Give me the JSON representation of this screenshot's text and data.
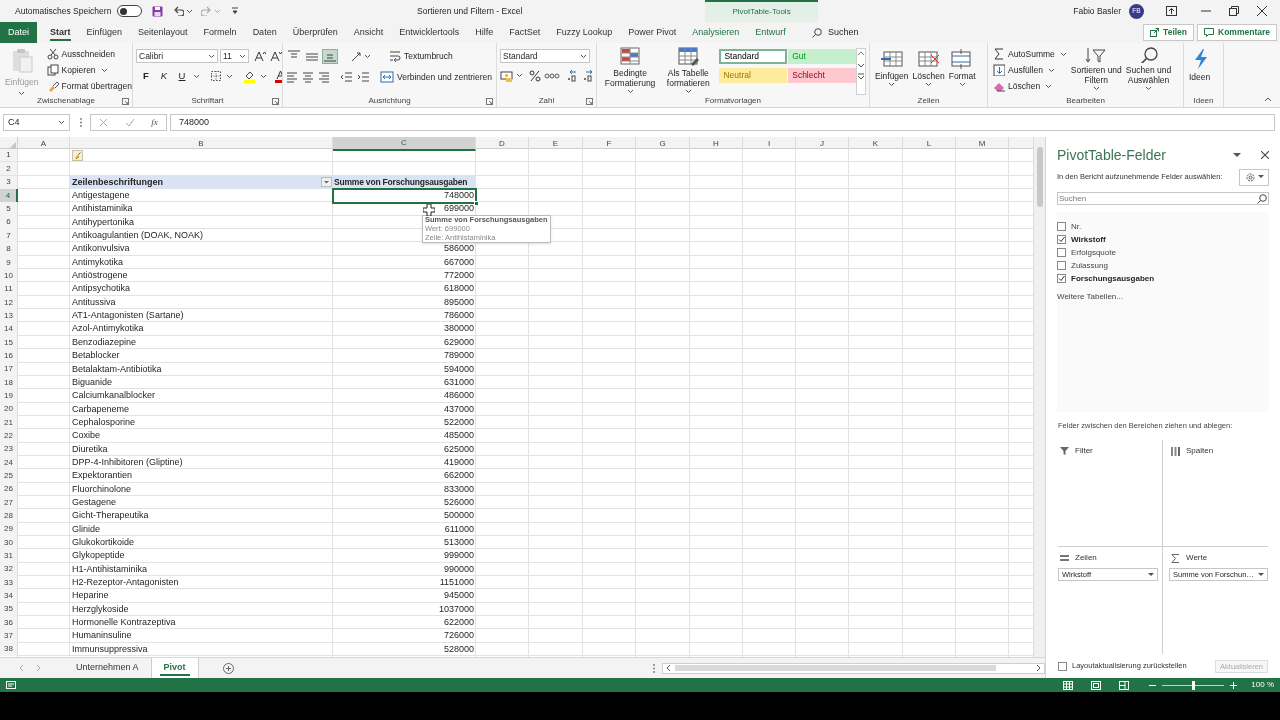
{
  "title_bar": {
    "autosave_label": "Automatisches Speichern",
    "autosave_on": false,
    "title": "Sortieren und Filtern - Excel",
    "context_tab": "PivotTable-Tools",
    "user": "Fabio Basler",
    "avatar": "FB"
  },
  "tabs": [
    {
      "label": "Datei",
      "kind": "file",
      "selected": false
    },
    {
      "label": "Start",
      "kind": "normal",
      "selected": true
    },
    {
      "label": "Einfügen",
      "kind": "normal",
      "selected": false
    },
    {
      "label": "Seitenlayout",
      "kind": "normal",
      "selected": false
    },
    {
      "label": "Formeln",
      "kind": "normal",
      "selected": false
    },
    {
      "label": "Daten",
      "kind": "normal",
      "selected": false
    },
    {
      "label": "Überprüfen",
      "kind": "normal",
      "selected": false
    },
    {
      "label": "Ansicht",
      "kind": "normal",
      "selected": false
    },
    {
      "label": "Entwicklertools",
      "kind": "normal",
      "selected": false
    },
    {
      "label": "Hilfe",
      "kind": "normal",
      "selected": false
    },
    {
      "label": "FactSet",
      "kind": "normal",
      "selected": false
    },
    {
      "label": "Fuzzy Lookup",
      "kind": "normal",
      "selected": false
    },
    {
      "label": "Power Pivot",
      "kind": "normal",
      "selected": false
    },
    {
      "label": "Analysieren",
      "kind": "context",
      "selected": false
    },
    {
      "label": "Entwurf",
      "kind": "context",
      "selected": false
    }
  ],
  "search": {
    "label": "Suchen"
  },
  "header_buttons": [
    {
      "label": "Teilen",
      "kind": "share"
    },
    {
      "label": "Kommentare",
      "kind": "comments"
    }
  ],
  "ribbon": {
    "groups": [
      {
        "kind": "clipboard",
        "label": "Zwischenablage",
        "items": [
          {
            "label": "Einfügen",
            "disabled": true
          },
          {
            "label": "Ausschneiden",
            "disabled": false
          },
          {
            "label": "Kopieren",
            "disabled": false
          },
          {
            "label": "Format übertragen",
            "disabled": false
          }
        ]
      },
      {
        "kind": "font",
        "label": "Schriftart",
        "font": "Calibri",
        "size": "11",
        "items": [
          {
            "label": "F",
            "kind": "bold"
          },
          {
            "label": "K",
            "kind": "italic"
          },
          {
            "label": "U",
            "kind": "underline"
          }
        ]
      },
      {
        "kind": "alignment",
        "label": "Ausrichtung",
        "align_buttons": [
          {
            "selected": false
          },
          {
            "selected": false
          },
          {
            "selected": true
          }
        ],
        "items": [
          {
            "label": "Textumbruch"
          },
          {
            "label": "Verbinden und zentrieren"
          }
        ]
      },
      {
        "kind": "number",
        "label": "Zahl",
        "format": "Standard"
      },
      {
        "kind": "styles",
        "label": "Formatvorlagen",
        "items": [
          {
            "label": "Bedingte\nFormatierung"
          },
          {
            "label": "Als Tabelle\nformatieren"
          }
        ],
        "styles": [
          {
            "label": "Standard",
            "color": "#ffffff"
          },
          {
            "label": "Gut",
            "color": "#c6efce"
          },
          {
            "label": "Neutral",
            "color": "#ffeb9c"
          },
          {
            "label": "Schlecht",
            "color": "#ffc7ce"
          }
        ]
      },
      {
        "kind": "cells",
        "label": "Zellen",
        "items": [
          {
            "label": "Einfügen"
          },
          {
            "label": "Löschen"
          },
          {
            "label": "Format"
          }
        ]
      },
      {
        "kind": "editing",
        "label": "Bearbeiten",
        "items": [
          {
            "label": "AutoSumme",
            "kind": "small"
          },
          {
            "label": "Ausfüllen",
            "kind": "small"
          },
          {
            "label": "Löschen",
            "kind": "small"
          },
          {
            "label": "Sortieren und\nFiltern",
            "kind": "large"
          },
          {
            "label": "Suchen und\nAuswählen",
            "kind": "large"
          }
        ]
      },
      {
        "kind": "ideas",
        "label": "Ideen",
        "items": [
          {
            "label": "Ideen"
          }
        ]
      }
    ]
  },
  "formula_bar": {
    "name_box": "C4",
    "function_button": "fx",
    "value": "748000"
  },
  "sheet": {
    "columns": [
      {
        "label": "A",
        "selected": false
      },
      {
        "label": "B",
        "selected": false
      },
      {
        "label": "C",
        "selected": true
      },
      {
        "label": "D",
        "selected": false
      },
      {
        "label": "E",
        "selected": false
      },
      {
        "label": "F",
        "selected": false
      },
      {
        "label": "G",
        "selected": false
      },
      {
        "label": "H",
        "selected": false
      },
      {
        "label": "I",
        "selected": false
      },
      {
        "label": "J",
        "selected": false
      },
      {
        "label": "K",
        "selected": false
      },
      {
        "label": "L",
        "selected": false
      },
      {
        "label": "M",
        "selected": false
      }
    ],
    "rows": [
      {
        "number": "1",
        "kind": "icon_row",
        "selected": false
      },
      {
        "number": "2",
        "kind": "empty",
        "selected": false
      },
      {
        "number": "3",
        "kind": "header",
        "selected": false,
        "label": "Zeilenbeschriftungen",
        "value": "Summe von Forschungsausgaben"
      },
      {
        "number": "4",
        "kind": "data",
        "selected": true,
        "label": "Antigestagene",
        "value": "748000"
      },
      {
        "number": "5",
        "kind": "data",
        "selected": false,
        "label": "Antihistaminika",
        "value": "699000"
      },
      {
        "number": "6",
        "kind": "data",
        "selected": false,
        "label": "Antihypertonika"
      },
      {
        "number": "7",
        "kind": "data",
        "selected": false,
        "label": "Antikoagulantien (DOAK, NOAK)"
      },
      {
        "number": "8",
        "kind": "data",
        "selected": false,
        "label": "Antikonvulsiva",
        "value": "586000"
      },
      {
        "number": "9",
        "kind": "data",
        "selected": false,
        "label": "Antimykotika",
        "value": "667000"
      },
      {
        "number": "10",
        "kind": "data",
        "selected": false,
        "label": "Antiöstrogene",
        "value": "772000"
      },
      {
        "number": "11",
        "kind": "data",
        "selected": false,
        "label": "Antipsychotika",
        "value": "618000"
      },
      {
        "number": "12",
        "kind": "data",
        "selected": false,
        "label": "Antitussiva",
        "value": "895000"
      },
      {
        "number": "13",
        "kind": "data",
        "selected": false,
        "label": "AT1-Antagonisten (Sartane)",
        "value": "786000"
      },
      {
        "number": "14",
        "kind": "data",
        "selected": false,
        "label": "Azol-Antimykotika",
        "value": "380000"
      },
      {
        "number": "15",
        "kind": "data",
        "selected": false,
        "label": "Benzodiazepine",
        "value": "629000"
      },
      {
        "number": "16",
        "kind": "data",
        "selected": false,
        "label": "Betablocker",
        "value": "789000"
      },
      {
        "number": "17",
        "kind": "data",
        "selected": false,
        "label": "Betalaktam-Antibiotika",
        "value": "594000"
      },
      {
        "number": "18",
        "kind": "data",
        "selected": false,
        "label": "Biguanide",
        "value": "631000"
      },
      {
        "number": "19",
        "kind": "data",
        "selected": false,
        "label": "Calciumkanalblocker",
        "value": "486000"
      },
      {
        "number": "20",
        "kind": "data",
        "selected": false,
        "label": "Carbapeneme",
        "value": "437000"
      },
      {
        "number": "21",
        "kind": "data",
        "selected": false,
        "label": "Cephalosporine",
        "value": "522000"
      },
      {
        "number": "22",
        "kind": "data",
        "selected": false,
        "label": "Coxibe",
        "value": "485000"
      },
      {
        "number": "23",
        "kind": "data",
        "selected": false,
        "label": "Diuretika",
        "value": "625000"
      },
      {
        "number": "24",
        "kind": "data",
        "selected": false,
        "label": "DPP-4-Inhibitoren (Gliptine)",
        "value": "419000"
      },
      {
        "number": "25",
        "kind": "data",
        "selected": false,
        "label": "Expektorantien",
        "value": "662000"
      },
      {
        "number": "26",
        "kind": "data",
        "selected": false,
        "label": "Fluorchinolone",
        "value": "833000"
      },
      {
        "number": "27",
        "kind": "data",
        "selected": false,
        "label": "Gestagene",
        "value": "526000"
      },
      {
        "number": "28",
        "kind": "data",
        "selected": false,
        "label": "Gicht-Therapeutika",
        "value": "500000"
      },
      {
        "number": "29",
        "kind": "data",
        "selected": false,
        "label": "Glinide",
        "value": "611000"
      },
      {
        "number": "30",
        "kind": "data",
        "selected": false,
        "label": "Glukokortikoide",
        "value": "513000"
      },
      {
        "number": "31",
        "kind": "data",
        "selected": false,
        "label": "Glykopeptide",
        "value": "999000"
      },
      {
        "number": "32",
        "kind": "data",
        "selected": false,
        "label": "H1-Antihistaminika",
        "value": "990000"
      },
      {
        "number": "33",
        "kind": "data",
        "selected": false,
        "label": "H2-Rezeptor-Antagonisten",
        "value": "1151000"
      },
      {
        "number": "34",
        "kind": "data",
        "selected": false,
        "label": "Heparine",
        "value": "945000"
      },
      {
        "number": "35",
        "kind": "data",
        "selected": false,
        "label": "Herzglykoside",
        "value": "1037000"
      },
      {
        "number": "36",
        "kind": "data",
        "selected": false,
        "label": "Hormonelle Kontrazeptiva",
        "value": "622000"
      },
      {
        "number": "37",
        "kind": "data",
        "selected": false,
        "label": "Humaninsuline",
        "value": "726000"
      },
      {
        "number": "38",
        "kind": "data",
        "selected": false,
        "label": "Immunsuppressiva",
        "value": "528000"
      }
    ],
    "tooltip": {
      "title": "Summe von Forschungsausgaben",
      "lines": [
        "Wert: 699000",
        "Zeile: Antihistaminika"
      ]
    }
  },
  "sheet_tabs": [
    {
      "label": "Unternehmen A",
      "selected": false
    },
    {
      "label": "Pivot",
      "selected": true
    }
  ],
  "status_bar": {
    "zoom": "100 %",
    "zoom_slider": {
      "level": 0.5
    }
  },
  "pivot_pane": {
    "title": "PivotTable-Felder",
    "subtitle": "In den Bericht aufzunehmende Felder auswählen:",
    "search_placeholder": "Suchen",
    "fields": [
      {
        "label": "Nr.",
        "checked": false
      },
      {
        "label": "Wirkstoff",
        "checked": true
      },
      {
        "label": "Erfolgsquote",
        "checked": false
      },
      {
        "label": "Zulassung",
        "checked": false
      },
      {
        "label": "Forschungsausgaben",
        "checked": true
      }
    ],
    "more_tables": "Weitere Tabellen...",
    "areas_hint": "Felder zwischen den Bereichen ziehen und ablegen:",
    "areas": [
      {
        "label": "Filter",
        "kind": "filter"
      },
      {
        "label": "Spalten",
        "kind": "columns"
      },
      {
        "label": "Zeilen",
        "kind": "rows",
        "items": [
          "Wirkstoff"
        ]
      },
      {
        "label": "Werte",
        "kind": "values",
        "items": [
          "Summe von Forschun…"
        ]
      }
    ],
    "defer": {
      "label": "Layoutaktualisierung zurückstellen",
      "checked": false
    },
    "update_button": {
      "label": "Aktualisieren",
      "disabled": true
    }
  }
}
